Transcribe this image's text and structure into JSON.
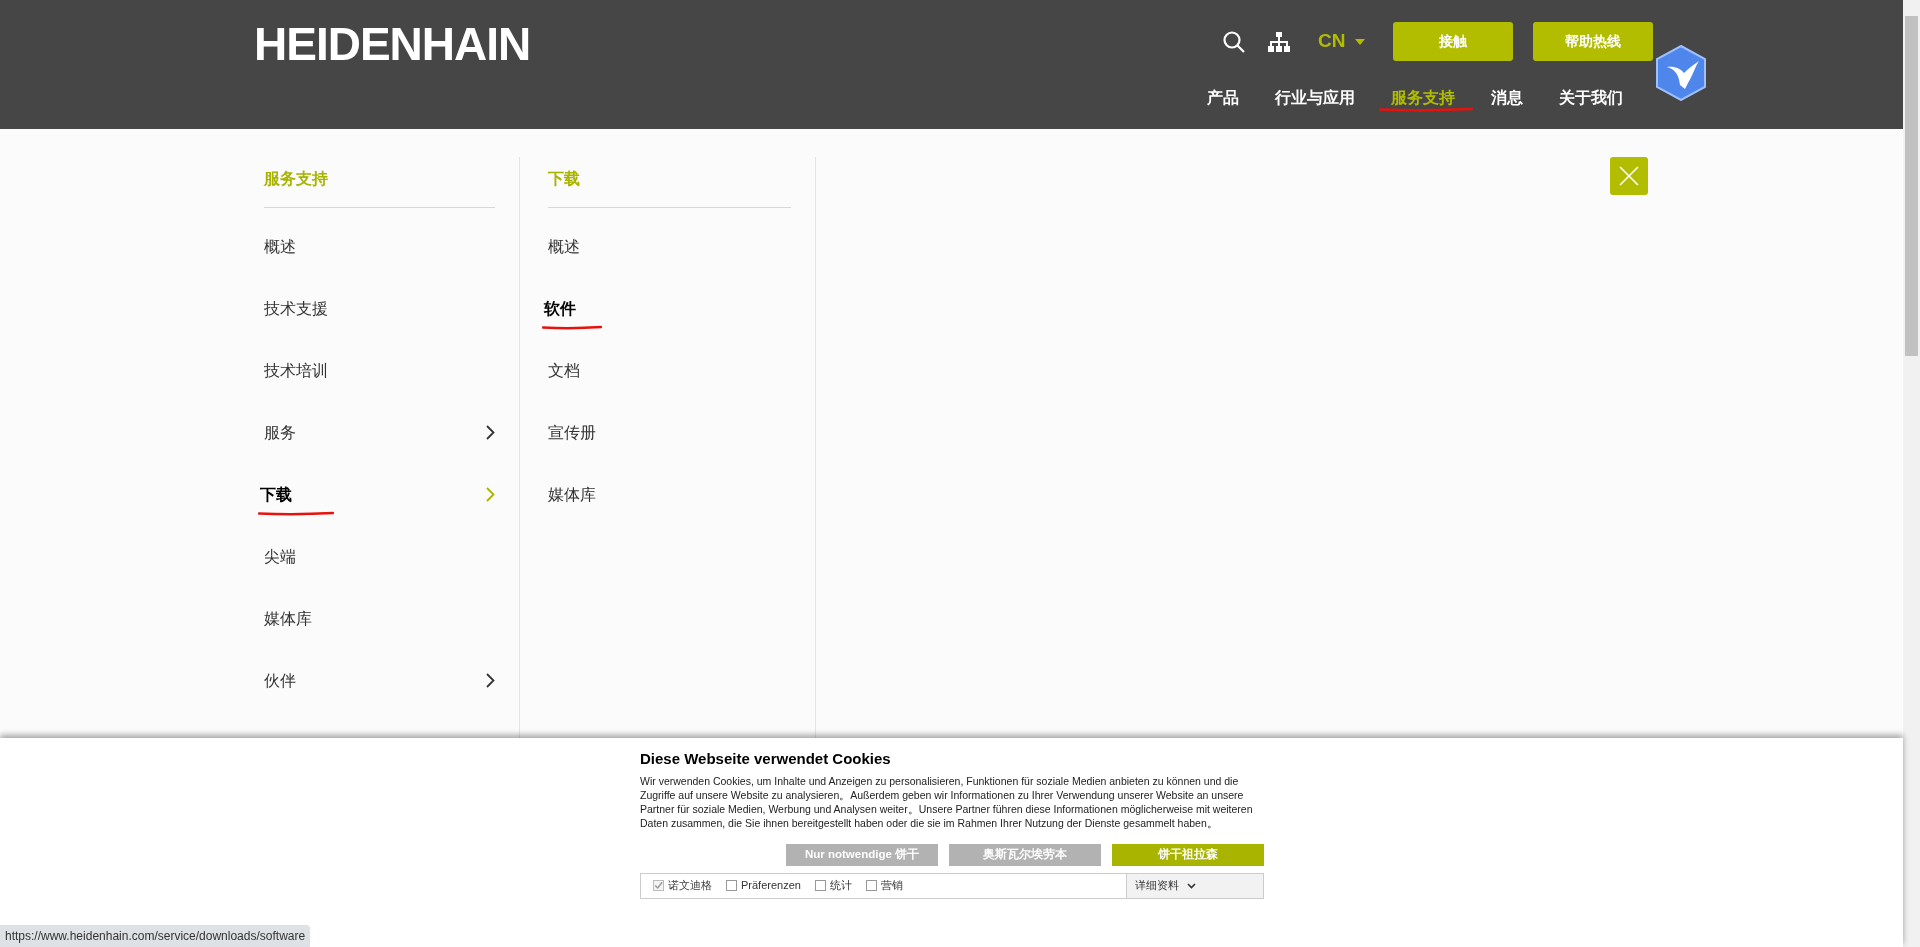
{
  "header": {
    "logo": "HEIDENHAIN",
    "language": "CN",
    "buttons": [
      "接触",
      "帮助热线"
    ],
    "nav": [
      {
        "label": "产品",
        "selected": false,
        "annotated": false
      },
      {
        "label": "行业与应用",
        "selected": false,
        "annotated": false
      },
      {
        "label": "服务支持",
        "selected": true,
        "annotated": true
      },
      {
        "label": "消息",
        "selected": false,
        "annotated": false
      },
      {
        "label": "关于我们",
        "selected": false,
        "annotated": false
      }
    ]
  },
  "menu": {
    "columns": [
      {
        "heading": "服务支持",
        "items": [
          {
            "label": "概述",
            "selected": false,
            "annotated": false,
            "has_children": false
          },
          {
            "label": "技术支援",
            "selected": false,
            "annotated": false,
            "has_children": false
          },
          {
            "label": "技术培训",
            "selected": false,
            "annotated": false,
            "has_children": false
          },
          {
            "label": "服务",
            "selected": false,
            "annotated": false,
            "has_children": true
          },
          {
            "label": "下载",
            "selected": true,
            "annotated": true,
            "has_children": true
          },
          {
            "label": "尖端",
            "selected": false,
            "annotated": false,
            "has_children": false
          },
          {
            "label": "媒体库",
            "selected": false,
            "annotated": false,
            "has_children": false
          },
          {
            "label": "伙伴",
            "selected": false,
            "annotated": false,
            "has_children": true
          }
        ]
      },
      {
        "heading": "下载",
        "items": [
          {
            "label": "概述",
            "selected": false,
            "annotated": false,
            "has_children": false
          },
          {
            "label": "软件",
            "selected": true,
            "annotated": true,
            "has_children": false
          },
          {
            "label": "文档",
            "selected": false,
            "annotated": false,
            "has_children": false
          },
          {
            "label": "宣传册",
            "selected": false,
            "annotated": false,
            "has_children": false
          },
          {
            "label": "媒体库",
            "selected": false,
            "annotated": false,
            "has_children": false
          }
        ]
      }
    ]
  },
  "cookie_banner": {
    "title": "Diese Webseite verwendet Cookies",
    "text": "Wir verwenden Cookies, um Inhalte und Anzeigen zu personalisieren, Funktionen für soziale Medien anbieten zu können und die Zugriffe auf unsere Website zu analysieren。Außerdem geben wir Informationen zu Ihrer Verwendung unserer Website an unsere Partner für soziale Medien, Werbung und Analysen weiter。Unsere Partner führen diese Informationen möglicherweise mit weiteren Daten zusammen, die Sie ihnen bereitgestellt haben oder die sie im Rahmen Ihrer Nutzung der Dienste gesammelt haben。",
    "buttons": [
      {
        "label": "Nur notwendige 饼干",
        "kind": "secondary"
      },
      {
        "label": "奥斯瓦尔埃劳本",
        "kind": "secondary"
      },
      {
        "label": "饼干祖拉森",
        "kind": "primary"
      }
    ],
    "options": [
      {
        "label": "诺文迪格",
        "checked": true,
        "disabled": true
      },
      {
        "label": "Präferenzen",
        "checked": false,
        "disabled": false
      },
      {
        "label": "统计",
        "checked": false,
        "disabled": false
      },
      {
        "label": "营销",
        "checked": false,
        "disabled": false
      }
    ],
    "details": "详细资料"
  },
  "status_bar": {
    "url": "https://www.heidenhain.com/service/downloads/software"
  }
}
